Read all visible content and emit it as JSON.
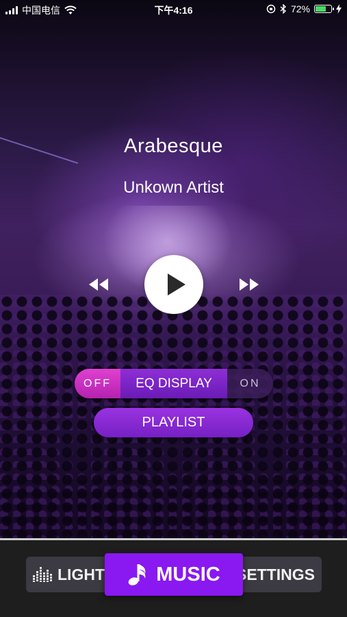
{
  "status_bar": {
    "carrier": "中国电信",
    "time": "下午4:16",
    "battery_percent": "72%",
    "battery_level": 0.72,
    "icons": [
      "signal-icon",
      "wifi-icon",
      "orientation-lock-icon",
      "bluetooth-icon",
      "battery-icon",
      "charging-icon"
    ]
  },
  "now_playing": {
    "title": "Arabesque",
    "artist": "Unkown Artist"
  },
  "controls": {
    "icons": [
      "rewind-icon",
      "play-icon",
      "fast-forward-icon"
    ]
  },
  "eq_toggle": {
    "off_label": "OFF",
    "label": "EQ DISPLAY",
    "on_label": "ON",
    "selected": "OFF"
  },
  "playlist": {
    "label": "PLAYLIST"
  },
  "tabs": {
    "light": {
      "label": "LIGHT",
      "icon": "equalizer-icon"
    },
    "music": {
      "label": "MUSIC",
      "icon": "music-note-icon"
    },
    "settings": {
      "label": "SETTINGS"
    },
    "active": "MUSIC"
  },
  "colors": {
    "accent_purple": "#8a18f0",
    "toggle_off_pink": "#d033c6",
    "battery_green": "#4cd964"
  }
}
